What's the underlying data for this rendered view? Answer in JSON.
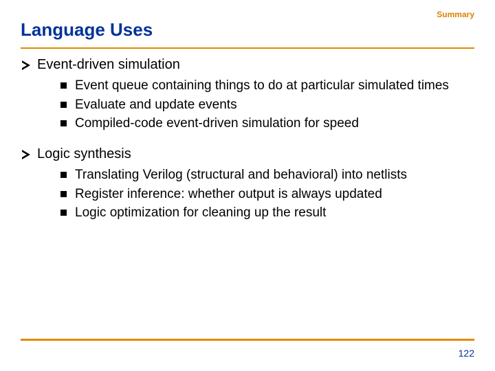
{
  "section_label": "Summary",
  "title": "Language Uses",
  "topics": [
    {
      "heading": "Event-driven simulation",
      "items": [
        "Event queue containing things to do at particular simulated times",
        "Evaluate and update events",
        "Compiled-code event-driven simulation for speed"
      ]
    },
    {
      "heading": "Logic synthesis",
      "items": [
        "Translating Verilog (structural and behavioral) into netlists",
        "Register inference: whether output is always updated",
        "Logic optimization for cleaning up the result"
      ]
    }
  ],
  "page_number": "122"
}
